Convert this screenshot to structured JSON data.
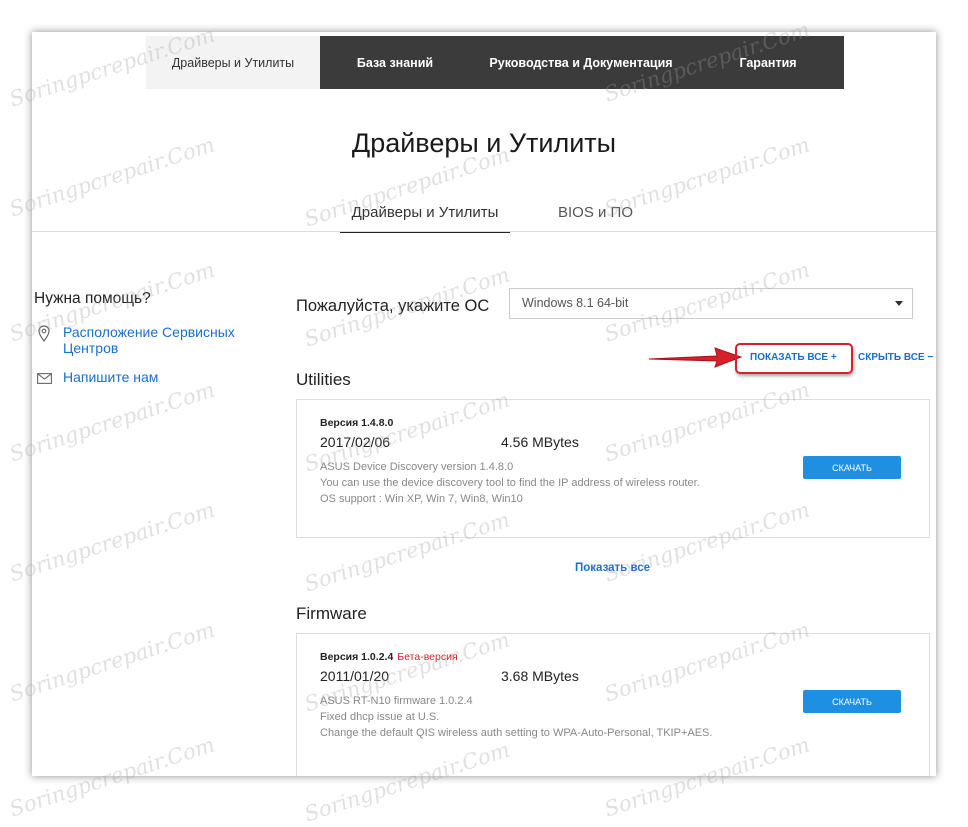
{
  "nav": {
    "tabs": [
      {
        "label": "Драйверы и Утилиты"
      },
      {
        "label": "База знаний"
      },
      {
        "label": "Руководства и Документация"
      },
      {
        "label": "Гарантия"
      }
    ]
  },
  "page_title": "Драйверы и Утилиты",
  "subtabs": [
    {
      "label": "Драйверы и Утилиты"
    },
    {
      "label": "BIOS и ПО"
    }
  ],
  "help": {
    "title": "Нужна помощь?",
    "service_centers": "Расположение Сервисных Центров",
    "write_us": "Напишите нам"
  },
  "os": {
    "label": "Пожалуйста, укажите ОС",
    "selected": "Windows 8.1 64-bit"
  },
  "controls": {
    "show_all": "ПОКАЗАТЬ ВСЕ",
    "show_all_icon": "+",
    "hide_all": "СКРЫТЬ ВСЕ",
    "hide_all_icon": "−",
    "show_all_link": "Показать все"
  },
  "sections": {
    "utilities": {
      "title": "Utilities",
      "item": {
        "version": "Версия 1.4.8.0",
        "date": "2017/02/06",
        "size": "4.56 MBytes",
        "description": "ASUS Device Discovery version 1.4.8.0\nYou can use the device discovery tool to find the IP address of wireless router.\nOS support : Win XP, Win 7, Win8, Win10",
        "download": "СКАЧАТЬ"
      }
    },
    "firmware": {
      "title": "Firmware",
      "item": {
        "version": "Версия 1.0.2.4",
        "beta": "Бета-версия",
        "date": "2011/01/20",
        "size": "3.68 MBytes",
        "description": "ASUS RT-N10 firmware 1.0.2.4\nFixed dhcp issue at U.S.\nChange the default QIS wireless auth setting to WPA-Auto-Personal, TKIP+AES.",
        "download": "СКАЧАТЬ"
      }
    }
  },
  "watermark": "Soringpcrepair.Com",
  "colors": {
    "link": "#1a6fc9",
    "download": "#1e8fe1",
    "highlight": "#d6202a",
    "nav_dark": "#3b3b3b"
  }
}
